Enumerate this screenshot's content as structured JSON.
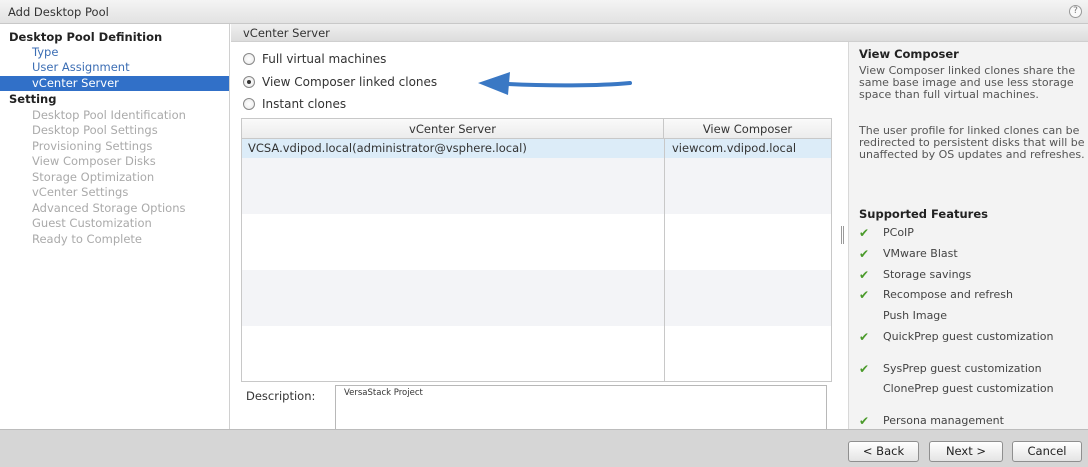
{
  "window": {
    "title": "Add Desktop Pool",
    "help_label": "?"
  },
  "nav": {
    "sections": [
      {
        "label": "Desktop Pool Definition"
      },
      {
        "label": "Setting"
      }
    ],
    "definition_items": [
      {
        "label": "Type",
        "state": "link"
      },
      {
        "label": "User Assignment",
        "state": "link"
      },
      {
        "label": "vCenter Server",
        "state": "selected"
      }
    ],
    "setting_items": [
      {
        "label": "Desktop Pool Identification",
        "state": "disabled"
      },
      {
        "label": "Desktop Pool Settings",
        "state": "disabled"
      },
      {
        "label": "Provisioning Settings",
        "state": "disabled"
      },
      {
        "label": "View Composer Disks",
        "state": "disabled"
      },
      {
        "label": "Storage Optimization",
        "state": "disabled"
      },
      {
        "label": "vCenter Settings",
        "state": "disabled"
      },
      {
        "label": "Advanced Storage Options",
        "state": "disabled"
      },
      {
        "label": "Guest Customization",
        "state": "disabled"
      },
      {
        "label": "Ready to Complete",
        "state": "disabled"
      }
    ]
  },
  "main": {
    "header": "vCenter Server",
    "radio_options": [
      {
        "label": "Full virtual machines",
        "checked": false
      },
      {
        "label": "View Composer linked clones",
        "checked": true
      },
      {
        "label": "Instant clones",
        "checked": false
      }
    ],
    "table": {
      "columns": [
        "vCenter Server",
        "View Composer"
      ],
      "rows": [
        [
          "VCSA.vdipod.local(administrator@vsphere.local)",
          "viewcom.vdipod.local"
        ]
      ]
    },
    "description": {
      "label": "Description:",
      "value": "VersaStack Project"
    }
  },
  "help_panel": {
    "title": "View Composer",
    "paragraphs": [
      "View Composer linked clones share the same base image and use less storage space than full virtual machines.",
      "The user profile for linked clones can be redirected to persistent disks that will be unaffected by OS updates and refreshes."
    ],
    "features_title": "Supported Features",
    "features": [
      {
        "label": "PCoIP",
        "supported": true
      },
      {
        "label": "VMware Blast",
        "supported": true
      },
      {
        "label": "Storage savings",
        "supported": true
      },
      {
        "label": "Recompose and refresh",
        "supported": true
      },
      {
        "label": "Push Image",
        "supported": false
      },
      {
        "label": "QuickPrep guest customization",
        "supported": true
      },
      {
        "label": "SysPrep guest customization",
        "supported": true
      },
      {
        "label": "ClonePrep guest customization",
        "supported": false
      },
      {
        "label": "Persona management",
        "supported": true
      }
    ]
  },
  "footer": {
    "back_label": "< Back",
    "next_label": "Next >",
    "cancel_label": "Cancel"
  },
  "colors": {
    "selected_nav": "#3170c8",
    "link": "#3c6eb4",
    "check": "#4a9a2a",
    "arrow": "#3a78c4",
    "row_selected": "#dcecf8"
  }
}
